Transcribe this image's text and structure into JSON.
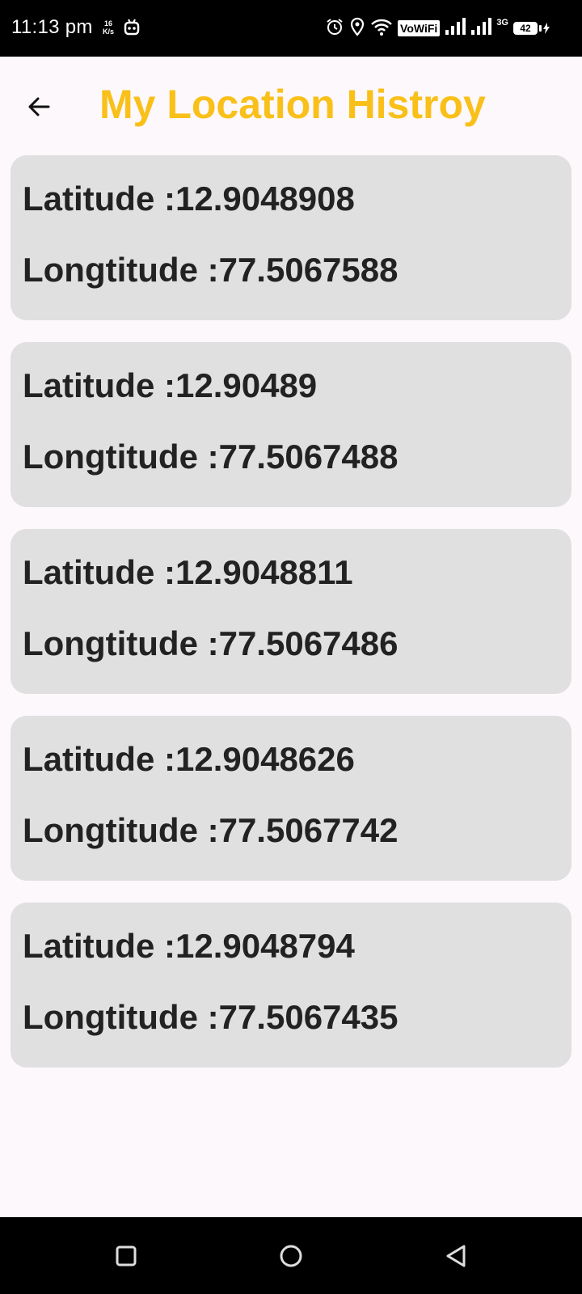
{
  "status_bar": {
    "time": "11:13 pm",
    "net_speed_value": "16",
    "net_speed_unit": "K/s",
    "vowifi": "VoWiFi",
    "net_type": "3G",
    "battery": "42"
  },
  "header": {
    "title": "My Location Histroy"
  },
  "locations": [
    {
      "lat_label": "Latitude :",
      "lat": "12.9048908",
      "lng_label": "Longtitude :",
      "lng": "77.5067588"
    },
    {
      "lat_label": "Latitude :",
      "lat": "12.90489",
      "lng_label": "Longtitude :",
      "lng": "77.5067488"
    },
    {
      "lat_label": "Latitude :",
      "lat": "12.9048811",
      "lng_label": "Longtitude :",
      "lng": "77.5067486"
    },
    {
      "lat_label": "Latitude :",
      "lat": "12.9048626",
      "lng_label": "Longtitude :",
      "lng": "77.5067742"
    },
    {
      "lat_label": "Latitude :",
      "lat": "12.9048794",
      "lng_label": "Longtitude :",
      "lng": "77.5067435"
    }
  ],
  "icons": {
    "back": "arrow-left-icon",
    "recents": "square-icon",
    "home": "circle-icon",
    "nav_back": "triangle-back-icon"
  }
}
